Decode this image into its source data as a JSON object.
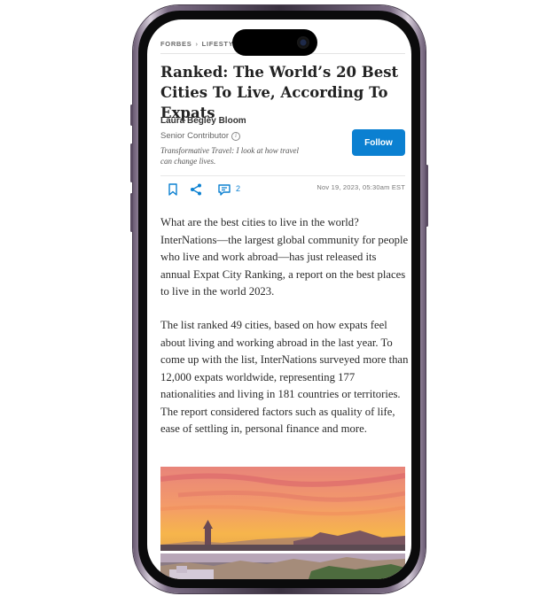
{
  "breadcrumb": {
    "site": "FORBES",
    "separator": "›",
    "section": "LIFESTYLE"
  },
  "article": {
    "headline": "Ranked: The World’s 20 Best Cities To Live, According To Expats",
    "author": "Laura Begley Bloom",
    "role": "Senior Contributor",
    "bio": "Transformative Travel: I look at how travel can change lives.",
    "follow_label": "Follow",
    "comment_count": "2",
    "date": "Nov 19, 2023, 05:30am EST",
    "paragraphs": [
      "What are the best cities to live in the world? InterNations—the largest global community for people who live and work abroad—has just released its annual Expat City Ranking, a report on the best places to live in the world 2023.",
      "The list ranked 49 cities, based on how expats feel about living and working abroad in the last year. To come up with the list, InterNations surveyed more than 12,000 expats worldwide, representing 177 nationalities and living in 181 countries or territories. The report considered factors such as quality of life, ease of settling in, personal finance and more."
    ]
  },
  "icons": {
    "bookmark": "bookmark-icon",
    "share": "share-icon",
    "comment": "comment-icon",
    "info": "info-icon",
    "camera": "front-camera-icon"
  },
  "colors": {
    "accent": "#0b80d1",
    "text": "#2a2a2a",
    "frame": "#3a3140",
    "sunset_top": "#f0836a",
    "sunset_bottom": "#f7b24a"
  }
}
